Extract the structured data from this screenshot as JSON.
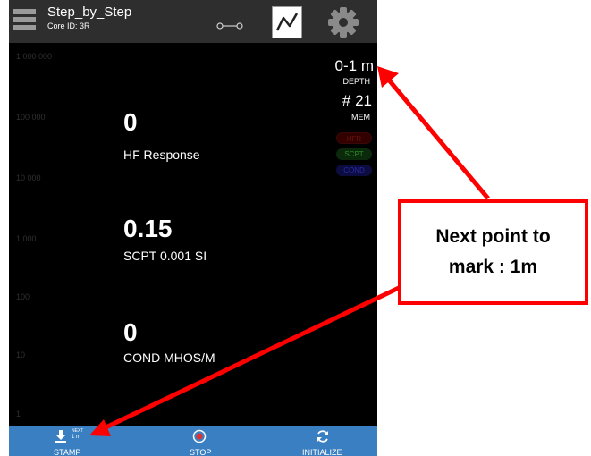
{
  "header": {
    "title": "Step_by_Step",
    "core_id": "Core ID: 3R",
    "menu_icon": "hamburger-icon",
    "link_icon": "link-icon",
    "chart_icon": "line-chart-icon",
    "settings_icon": "gear-icon"
  },
  "y_axis_labels": [
    "1 000 000",
    "100 000",
    "10 000",
    "1 000",
    "100",
    "10",
    "1"
  ],
  "status": {
    "depth_value": "0-1 m",
    "depth_label": "DEPTH",
    "mem_value": "# 21",
    "mem_label": "MEM",
    "badges": [
      "HFR",
      "SCPT",
      "COND"
    ]
  },
  "readings": [
    {
      "value": "0",
      "label": "HF Response"
    },
    {
      "value": "0.15",
      "label": "SCPT 0.001 SI"
    },
    {
      "value": "0",
      "label": "COND MHOS/M"
    }
  ],
  "bottom_bar": {
    "stamp_label": "STAMP",
    "next_label": "NEXT",
    "next_value": "1 m",
    "stop_label": "STOP",
    "initialize_label": "INITIALIZE"
  },
  "annotation": {
    "callout_text": "Next point to mark : 1m"
  },
  "colors": {
    "bottom_bar": "#3a7fc1",
    "annotation_red": "#ff0000"
  }
}
